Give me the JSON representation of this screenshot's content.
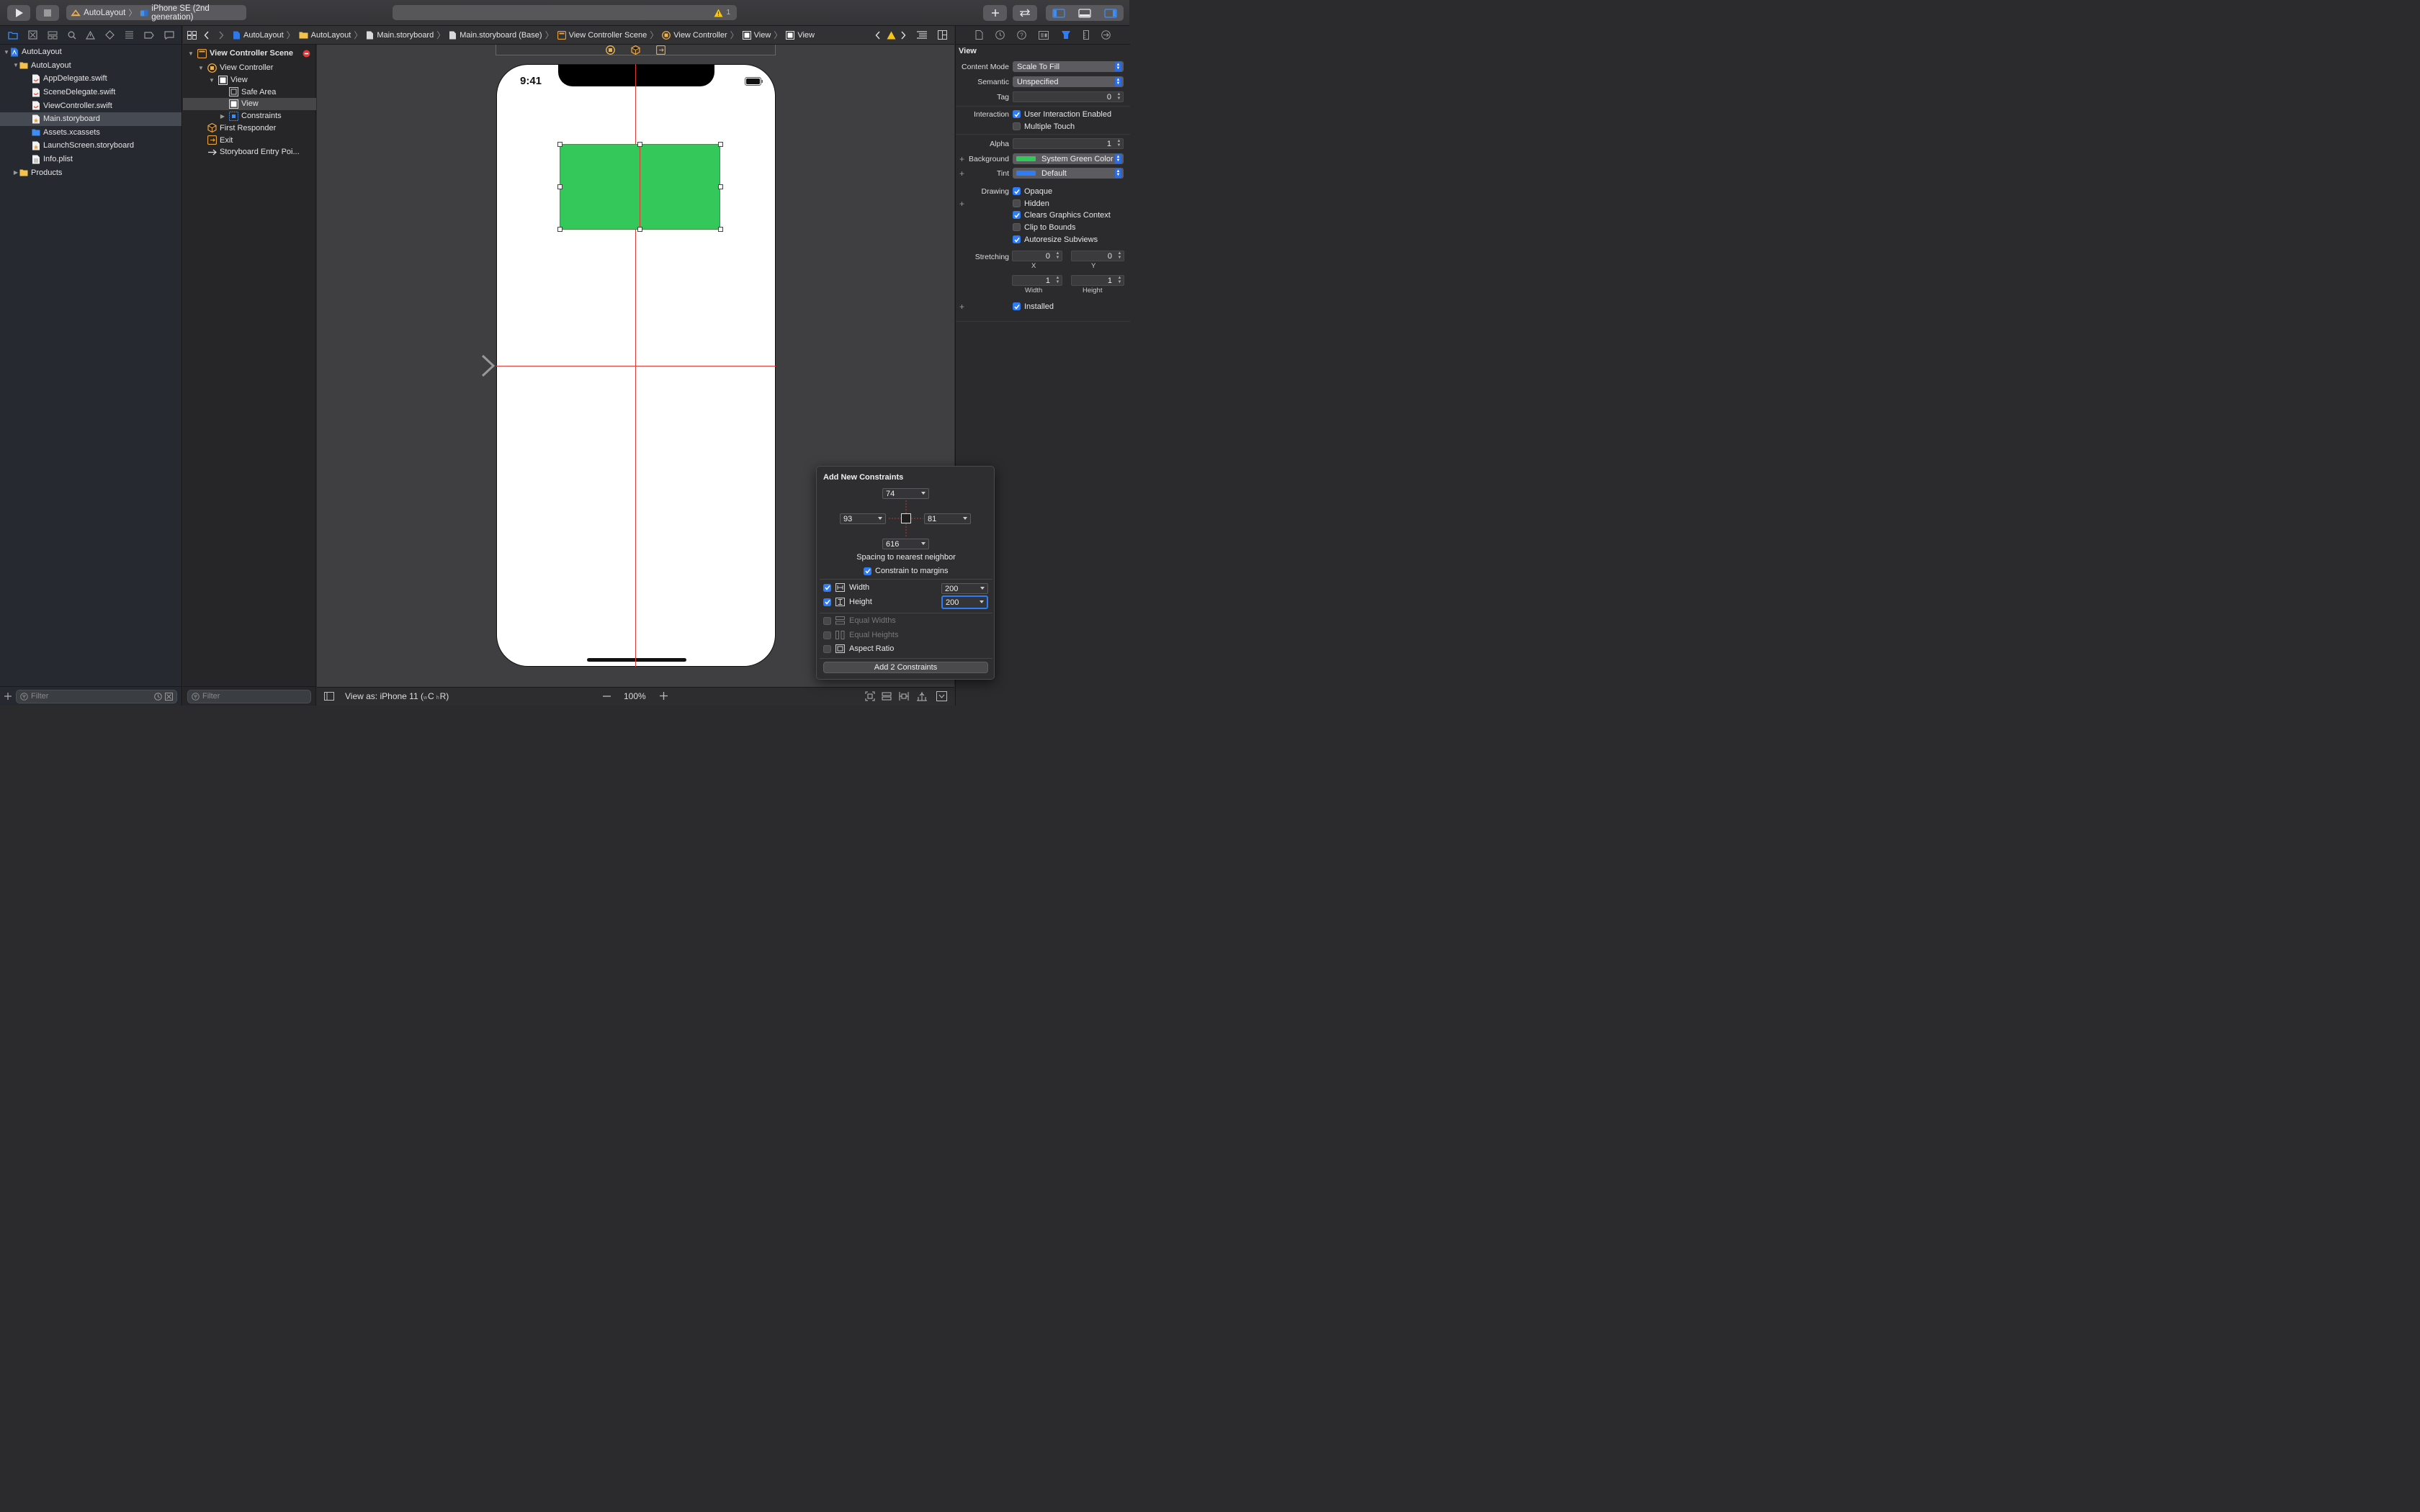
{
  "toolbar": {
    "scheme": "AutoLayout",
    "device": "iPhone SE (2nd generation)",
    "warning_count": "1"
  },
  "navigator": {
    "items": [
      {
        "label": "AutoLayout"
      },
      {
        "label": "AutoLayout"
      },
      {
        "label": "AppDelegate.swift"
      },
      {
        "label": "SceneDelegate.swift"
      },
      {
        "label": "ViewController.swift"
      },
      {
        "label": "Main.storyboard"
      },
      {
        "label": "Assets.xcassets"
      },
      {
        "label": "LaunchScreen.storyboard"
      },
      {
        "label": "Info.plist"
      },
      {
        "label": "Products"
      }
    ],
    "filter_placeholder": "Filter"
  },
  "jumpbar": {
    "crumbs": [
      "AutoLayout",
      "AutoLayout",
      "Main.storyboard",
      "Main.storyboard (Base)",
      "View Controller Scene",
      "View Controller",
      "View",
      "View"
    ]
  },
  "outline": {
    "items": [
      {
        "label": "View Controller Scene"
      },
      {
        "label": "View Controller"
      },
      {
        "label": "View"
      },
      {
        "label": "Safe Area"
      },
      {
        "label": "View"
      },
      {
        "label": "Constraints"
      },
      {
        "label": "First Responder"
      },
      {
        "label": "Exit"
      },
      {
        "label": "Storyboard Entry Poi..."
      }
    ],
    "filter_placeholder": "Filter"
  },
  "canvas": {
    "status_time": "9:41",
    "view_color": "#34c759",
    "guide_color": "#e0393a"
  },
  "bottombar": {
    "view_as_prefix": "View as: iPhone 11 (",
    "size_w": "w",
    "size_c": "C",
    "size_h": "h",
    "size_r": "R)",
    "zoom": "100%"
  },
  "inspector": {
    "section": "View",
    "content_mode_label": "Content Mode",
    "content_mode": "Scale To Fill",
    "semantic_label": "Semantic",
    "semantic": "Unspecified",
    "tag_label": "Tag",
    "tag": "0",
    "interaction_label": "Interaction",
    "user_interaction": "User Interaction Enabled",
    "multiple_touch": "Multiple Touch",
    "alpha_label": "Alpha",
    "alpha": "1",
    "background_label": "Background",
    "background": "System Green Color",
    "background_swatch": "#34c759",
    "tint_label": "Tint",
    "tint": "Default",
    "tint_swatch": "#2e7cf6",
    "drawing_label": "Drawing",
    "opaque": "Opaque",
    "hidden": "Hidden",
    "clears": "Clears Graphics Context",
    "clip": "Clip to Bounds",
    "autoresize": "Autoresize Subviews",
    "stretching_label": "Stretching",
    "stretch_x": "0",
    "stretch_y": "0",
    "stretch_w": "1",
    "stretch_h": "1",
    "x_label": "X",
    "y_label": "Y",
    "width_label": "Width",
    "height_label": "Height",
    "installed": "Installed"
  },
  "popover": {
    "title": "Add New Constraints",
    "top": "74",
    "left": "93",
    "right": "81",
    "bottom": "616",
    "spacing_label": "Spacing to nearest neighbor",
    "constrain_margins": "Constrain to margins",
    "width_label": "Width",
    "width": "200",
    "height_label": "Height",
    "height": "200",
    "equal_widths": "Equal Widths",
    "equal_heights": "Equal Heights",
    "aspect_ratio": "Aspect Ratio",
    "add_button": "Add 2 Constraints"
  }
}
